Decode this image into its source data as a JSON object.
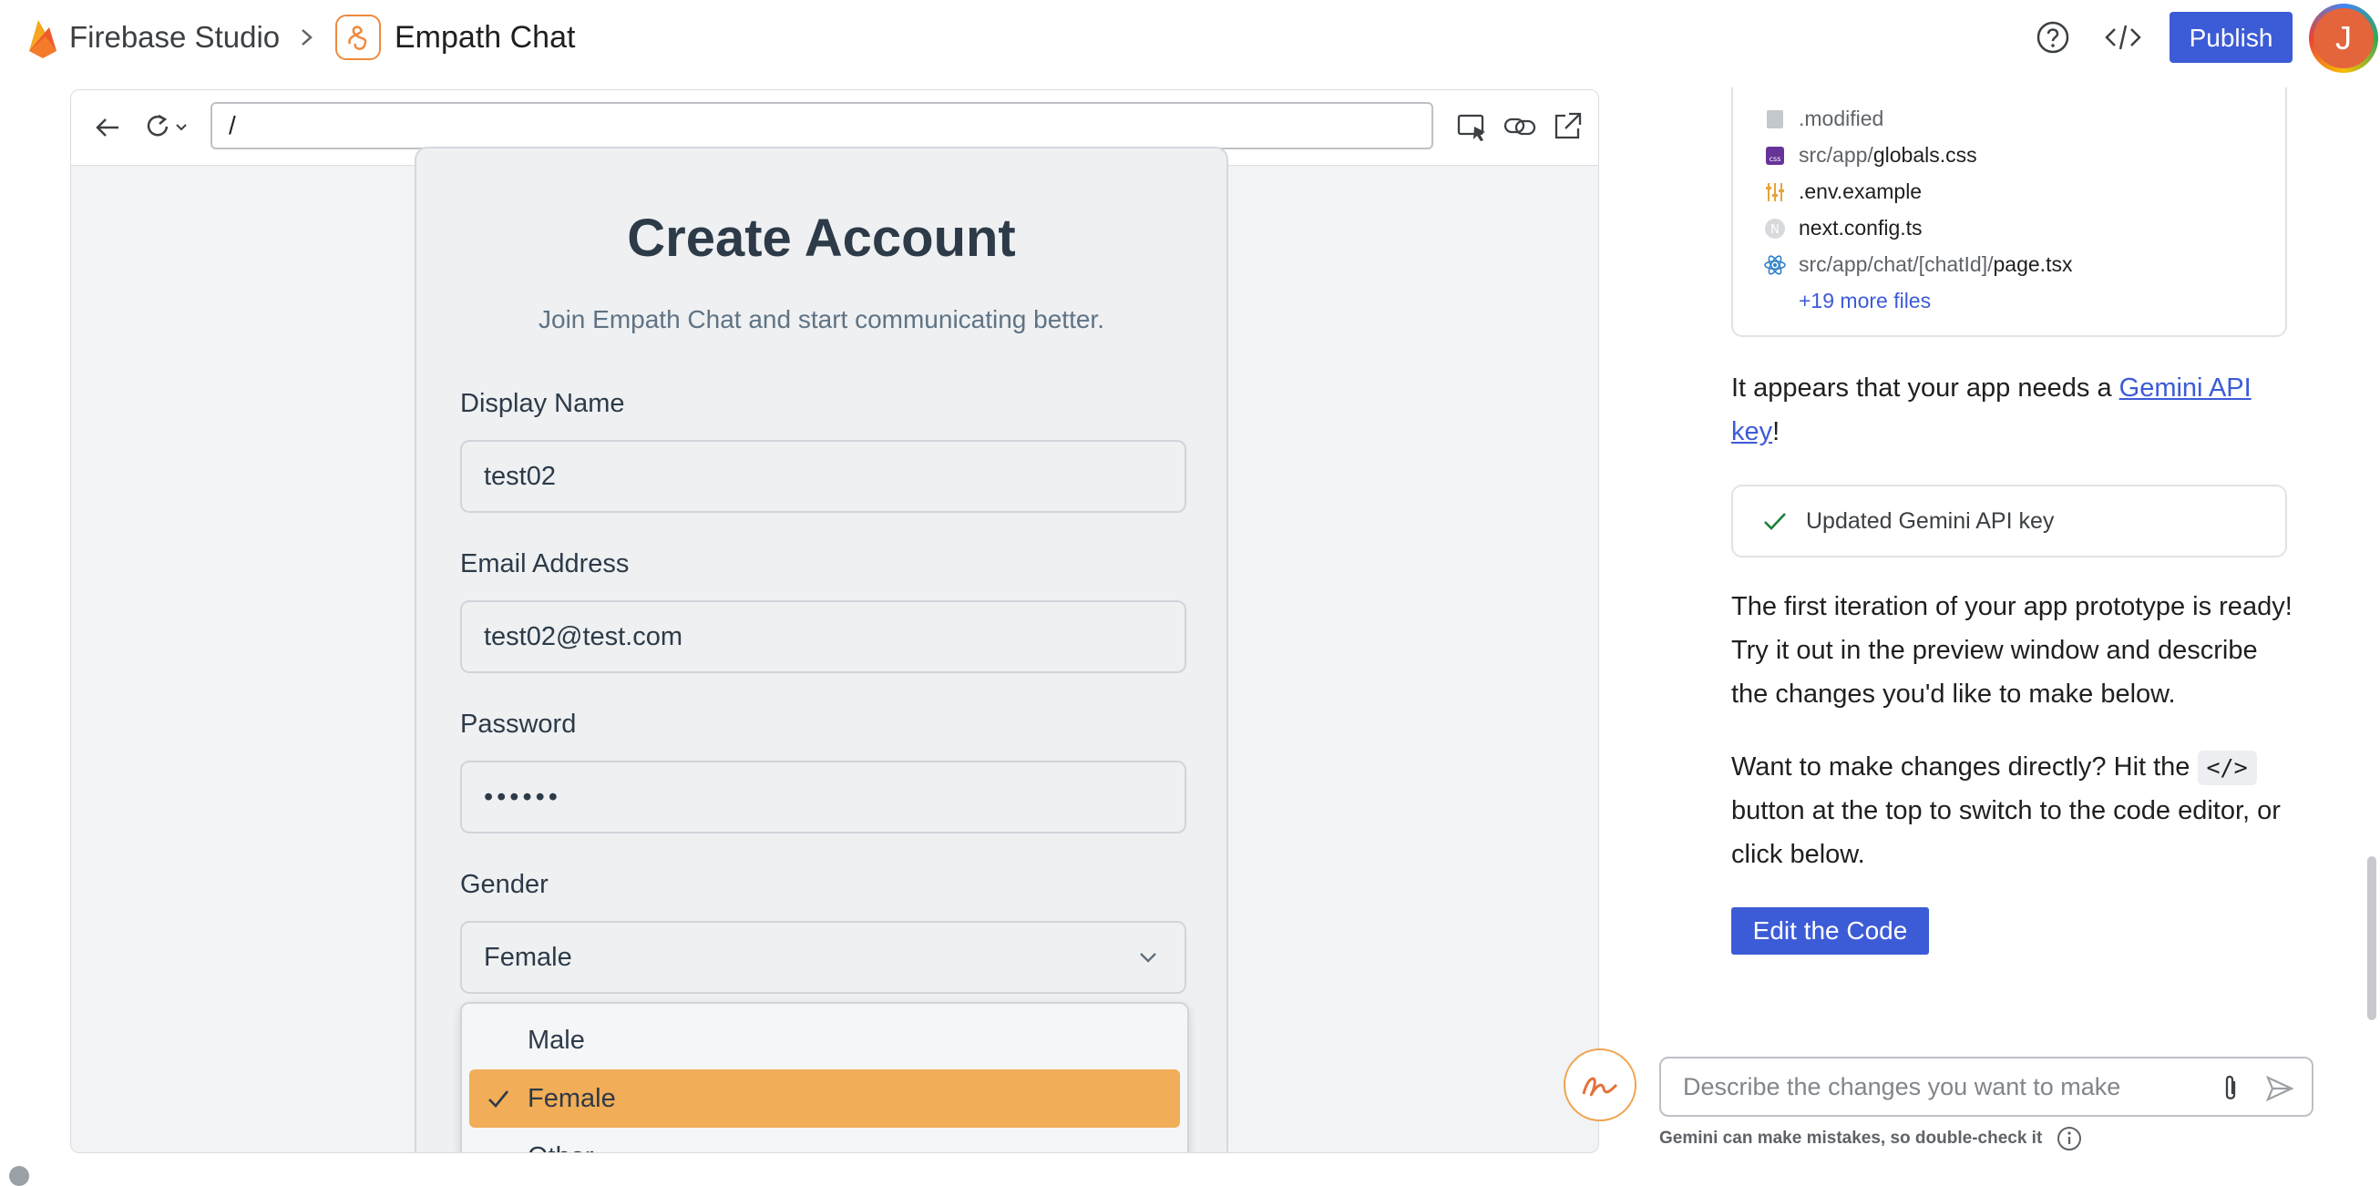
{
  "header": {
    "app_title": "Firebase Studio",
    "project_name": "Empath Chat",
    "publish_label": "Publish",
    "avatar_initial": "J"
  },
  "browser": {
    "url": "/"
  },
  "form": {
    "title": "Create Account",
    "subtitle": "Join Empath Chat and start communicating better.",
    "display_name_label": "Display Name",
    "display_name_value": "test02",
    "email_label": "Email Address",
    "email_value": "test02@test.com",
    "password_label": "Password",
    "password_value": "••••••",
    "gender_label": "Gender",
    "gender_value": "Female",
    "gender_options": [
      "Male",
      "Female",
      "Other"
    ]
  },
  "files": {
    "items": [
      {
        "prefix": "",
        "name": ".modified",
        "icon": "file-icon"
      },
      {
        "prefix": "src/app/",
        "name": "globals.css",
        "icon": "css-icon"
      },
      {
        "prefix": "",
        "name": ".env.example",
        "icon": "env-icon"
      },
      {
        "prefix": "",
        "name": "next.config.ts",
        "icon": "next-icon"
      },
      {
        "prefix": "src/app/chat/[chatId]/",
        "name": "page.tsx",
        "icon": "react-icon"
      }
    ],
    "more": "+19 more files"
  },
  "chat": {
    "api_key_prefix": "It appears that your app needs a ",
    "api_key_link_1": "Gemini API",
    "api_key_link_2": "key",
    "api_key_suffix": "!",
    "status_text": "Updated Gemini API key",
    "iteration_text": "The first iteration of your app prototype is ready! Try it out in the preview window and describe the changes you'd like to make below.",
    "direct_prefix": "Want to make changes directly? Hit the ",
    "direct_chip": "</>",
    "direct_suffix": " button at the top to switch to the code editor, or click below.",
    "edit_code_label": "Edit the Code",
    "prompt_placeholder": "Describe the changes you want to make",
    "disclaimer": "Gemini can make mistakes, so double-check it"
  },
  "colors": {
    "accent": "#3c5bd6",
    "selected_option": "#f1ad57",
    "project_icon": "#ef8a3c"
  }
}
